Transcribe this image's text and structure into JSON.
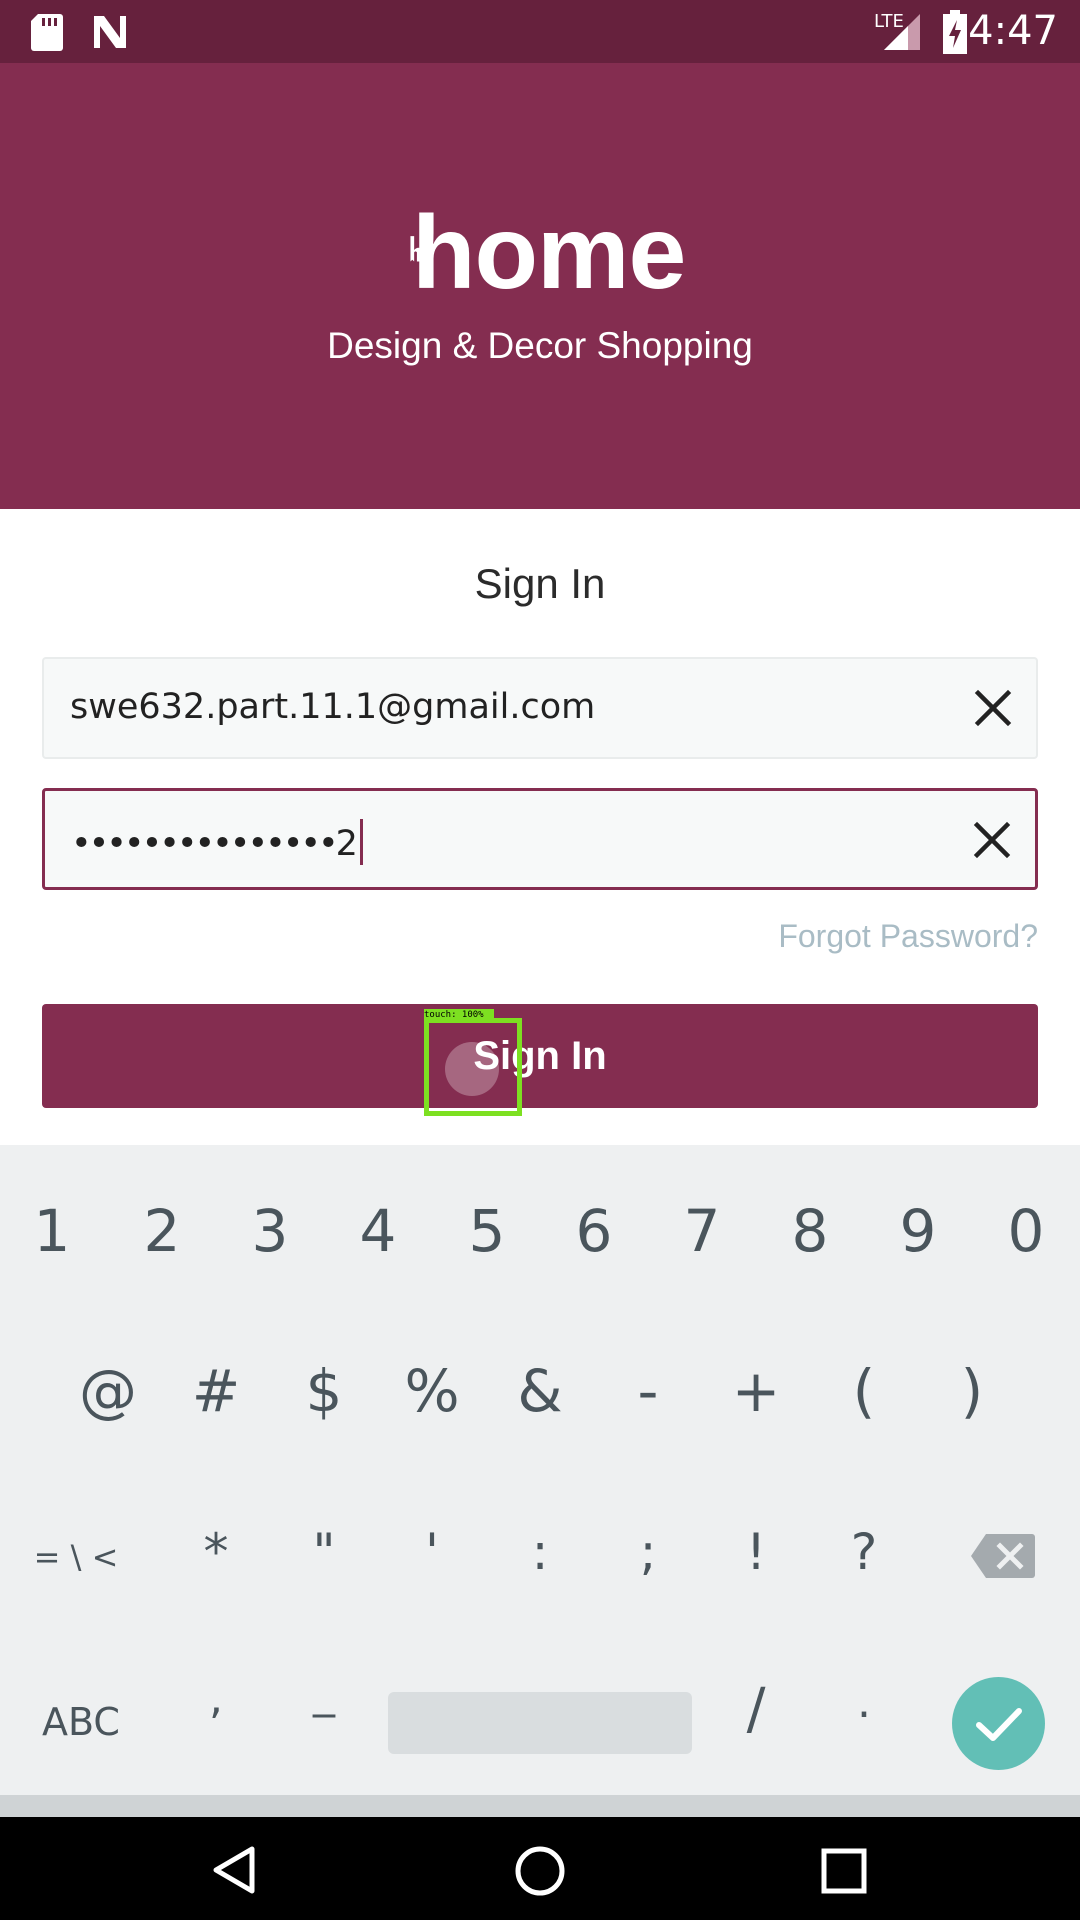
{
  "status_bar": {
    "time": "4:47",
    "network": "LTE",
    "left_icons": [
      "sd-card-icon",
      "n-notification-icon"
    ],
    "right_icons": [
      "lte-signal-icon",
      "battery-charging-icon"
    ]
  },
  "header": {
    "logo_text": "home",
    "tagline": "Design & Decor Shopping",
    "background": "#842d50"
  },
  "form": {
    "title": "Sign In",
    "email_value": "swe632.part.11.1@gmail.com",
    "password_masked": "•••••••••••••••",
    "password_last_char": "2",
    "forgot_password": "Forgot Password?",
    "submit_label": "Sign In"
  },
  "touch_overlay": {
    "label": "touch: 100%"
  },
  "keyboard": {
    "row1": [
      "1",
      "2",
      "3",
      "4",
      "5",
      "6",
      "7",
      "8",
      "9",
      "0"
    ],
    "row2": [
      "@",
      "#",
      "$",
      "%",
      "&",
      "-",
      "+",
      "(",
      ")"
    ],
    "row3": [
      "= \\ <",
      "*",
      "\"",
      "'",
      ":",
      ";",
      "!",
      "?"
    ],
    "row4": [
      "ABC",
      ",",
      "_",
      "/",
      "."
    ],
    "enter_color": "#62bfb6"
  },
  "nav_bar": {
    "icons": [
      "back-icon",
      "home-icon",
      "recents-icon"
    ]
  }
}
